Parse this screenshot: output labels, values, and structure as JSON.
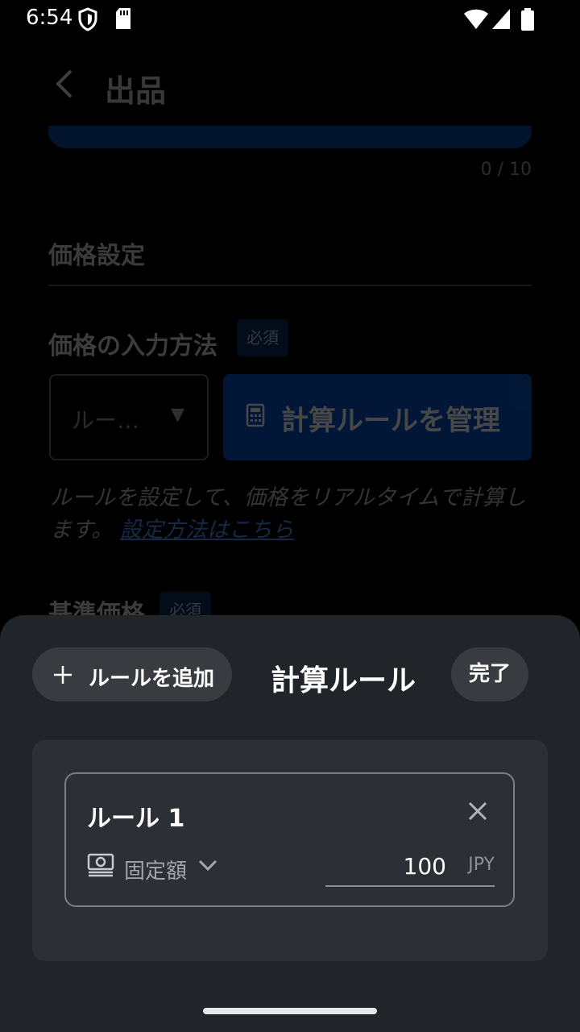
{
  "status_bar": {
    "time": "6:54",
    "icons": [
      "shield-icon",
      "sd-card-icon",
      "wifi-icon",
      "signal-icon",
      "battery-icon"
    ]
  },
  "background_page": {
    "title": "出品",
    "counter": "0 / 10",
    "section_heading": "価格設定",
    "price_input_label": "価格の入力方法",
    "required_badge": "必須",
    "method_select_value": "ルー…",
    "manage_rules_button": "計算ルールを管理",
    "help_text": "ルールを設定して、価格をリアルタイムで計算します。",
    "help_link": "設定方法はこちら",
    "base_price_label": "基準価格",
    "base_price_badge": "必須"
  },
  "sheet": {
    "add_rule_button": "ルールを追加",
    "title": "計算ルール",
    "done_button": "完了",
    "rules": [
      {
        "name": "ルール 1",
        "type": "固定額",
        "amount": "100",
        "unit": "JPY"
      }
    ]
  },
  "colors": {
    "accent_blue": "#0a55c4",
    "sheet_bg": "#212429",
    "card_bg": "#2c2f35"
  }
}
